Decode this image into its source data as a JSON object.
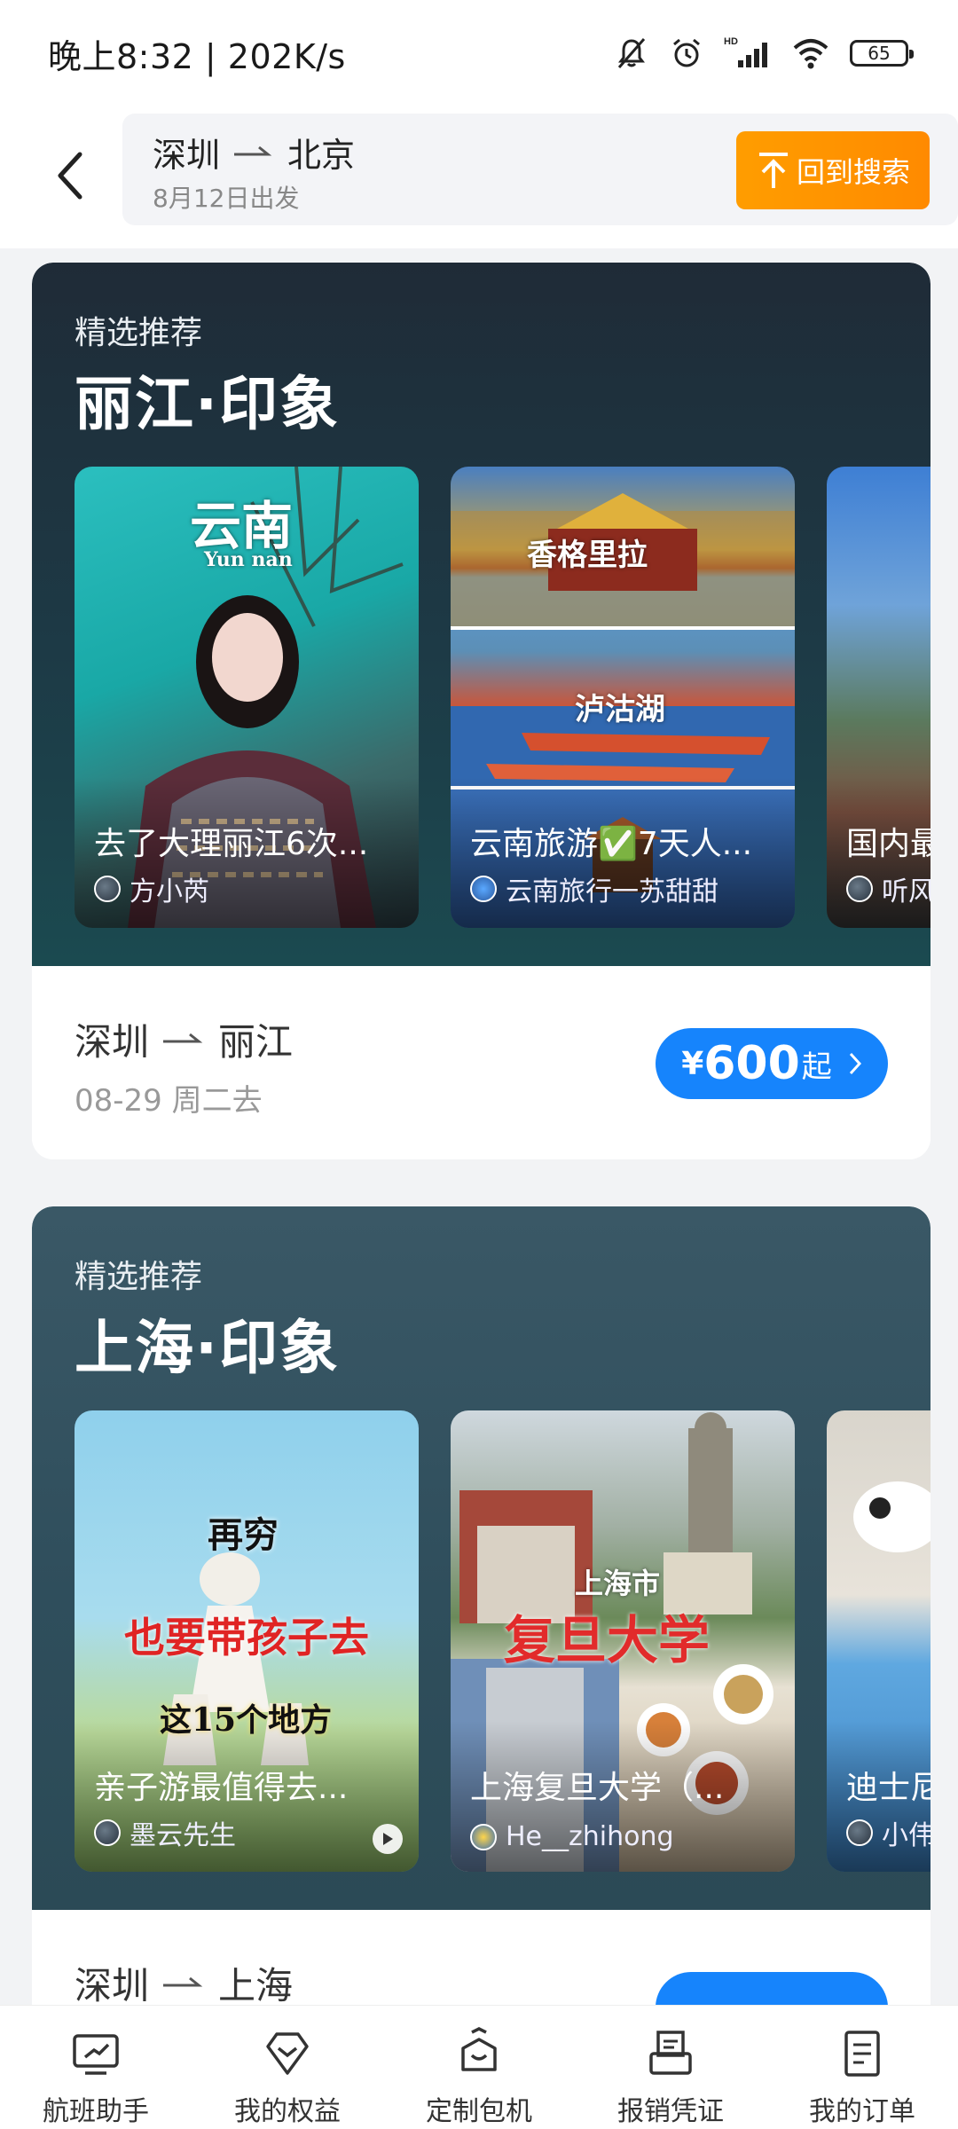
{
  "status_bar": {
    "time": "晚上8:32 | 202K/s",
    "battery": "65",
    "icons": [
      "mute-bell-icon",
      "alarm-icon",
      "hd-signal-icon",
      "wifi-icon",
      "battery-icon"
    ]
  },
  "header": {
    "origin": "深圳",
    "destination": "北京",
    "date": "8月12日出发",
    "back_to_search": "回到搜索"
  },
  "cards": [
    {
      "kicker": "精选推荐",
      "title": "丽江·印象",
      "thumbs": [
        {
          "title": "去了大理丽江6次...",
          "author": "方小芮",
          "overlay": "云南",
          "overlay_sub": "Yun nan"
        },
        {
          "title": "云南旅游✅7天人...",
          "author": "云南旅行一苏甜甜",
          "overlay": "香格里拉",
          "overlay2": "泸沽湖"
        },
        {
          "title": "国内最",
          "author": "听风"
        }
      ],
      "route": {
        "from": "深圳",
        "to": "丽江"
      },
      "date": "08-29 周二去",
      "price": {
        "currency": "¥",
        "amount": "600",
        "suffix": "起"
      }
    },
    {
      "kicker": "精选推荐",
      "title": "上海·印象",
      "thumbs": [
        {
          "title": "亲子游最值得去...",
          "author": "墨云先生",
          "overlay": "再穷",
          "overlay2": "也要带孩子去",
          "overlay3": "这15个地方"
        },
        {
          "title": "上海复旦大学（...",
          "author": "He__zhihong",
          "overlay": "上海市",
          "overlay2": "复旦大学"
        },
        {
          "title": "迪士尼",
          "author": "小伟"
        }
      ],
      "route": {
        "from": "深圳",
        "to": "上海"
      }
    }
  ],
  "bottom_nav": [
    {
      "label": "航班助手",
      "icon": "flight-assistant-icon"
    },
    {
      "label": "我的权益",
      "icon": "benefits-diamond-icon"
    },
    {
      "label": "定制包机",
      "icon": "charter-icon"
    },
    {
      "label": "报销凭证",
      "icon": "receipt-printer-icon"
    },
    {
      "label": "我的订单",
      "icon": "orders-icon"
    }
  ],
  "colors": {
    "accent_orange": "#ff9000",
    "price_blue": "#1684fc"
  }
}
